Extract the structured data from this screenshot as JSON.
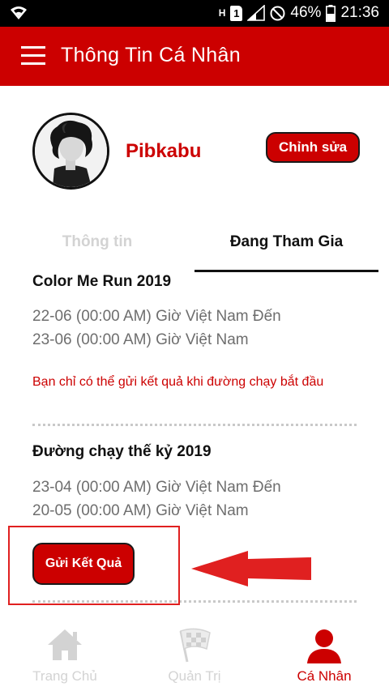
{
  "status_bar": {
    "network": "H",
    "sim": "1",
    "battery": "46%",
    "time": "21:36"
  },
  "app_bar": {
    "title": "Thông Tin Cá Nhân"
  },
  "profile": {
    "name": "Pibkabu",
    "edit_label": "Chỉnh sửa"
  },
  "tabs": [
    {
      "label": "Thông tin",
      "active": false
    },
    {
      "label": "Đang Tham Gia",
      "active": true
    }
  ],
  "events": [
    {
      "title": "Color Me Run 2019",
      "date_line1": "22-06 (00:00 AM) Giờ Việt Nam Đến",
      "date_line2": "23-06 (00:00 AM) Giờ Việt Nam",
      "note": "Bạn chỉ có thể gửi kết quả khi đường chạy bắt đầu"
    },
    {
      "title": "Đường chạy thế kỷ 2019",
      "date_line1": "23-04 (00:00 AM) Giờ Việt Nam Đến",
      "date_line2": "20-05 (00:00 AM) Giờ Việt Nam",
      "button_label": "Gửi Kết Quả"
    }
  ],
  "bottom_nav": [
    {
      "label": "Trang Chủ",
      "icon": "home-icon",
      "active": false
    },
    {
      "label": "Quản Trị",
      "icon": "checkered-flag-icon",
      "active": false
    },
    {
      "label": "Cá Nhân",
      "icon": "person-icon",
      "active": true
    }
  ],
  "colors": {
    "primary": "#cc0000",
    "inactive": "#d3d3d3",
    "annotation": "#e02020"
  }
}
